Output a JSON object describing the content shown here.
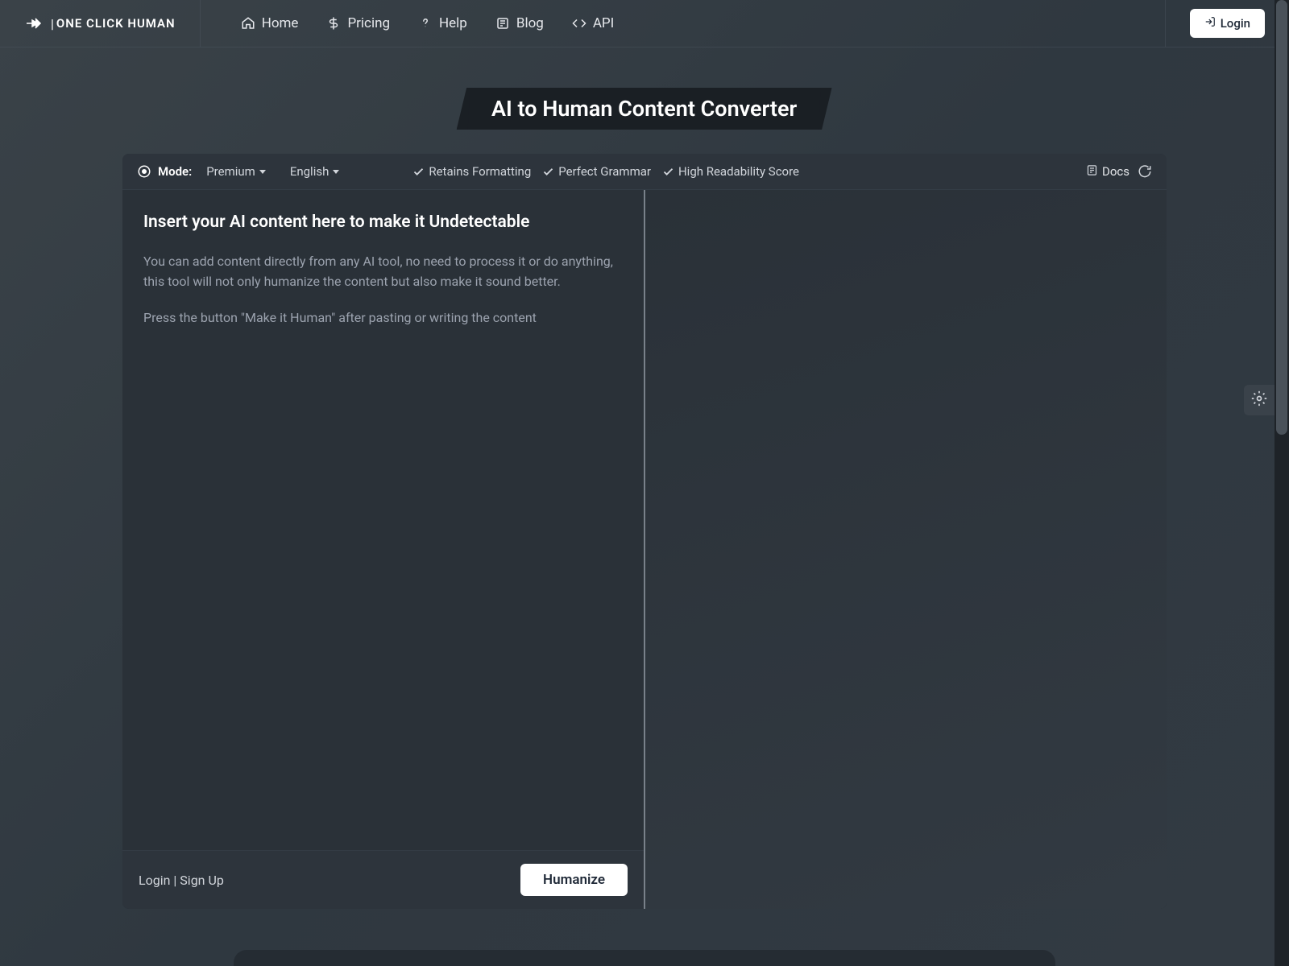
{
  "logo": {
    "brand": "ONE CLICK HUMAN"
  },
  "nav": {
    "home": "Home",
    "pricing": "Pricing",
    "help": "Help",
    "blog": "Blog",
    "api": "API"
  },
  "login_button": "Login",
  "page_title": "AI to Human Content Converter",
  "toolbar": {
    "mode_label": "Mode:",
    "mode_value": "Premium",
    "language_value": "English",
    "features": {
      "formatting": "Retains Formatting",
      "grammar": "Perfect Grammar",
      "readability": "High Readability Score"
    },
    "docs_label": "Docs"
  },
  "editor": {
    "heading": "Insert your AI content here to make it Undetectable",
    "paragraph1": "You can add content directly from any AI tool, no need to process it or do anything, this tool will not only humanize the content but also make it sound better.",
    "paragraph2": "Press the button \"Make it Human\" after pasting or writing the content"
  },
  "footer": {
    "login_link": "Login",
    "separator": " | ",
    "signup_link": "Sign Up",
    "humanize_button": "Humanize"
  }
}
